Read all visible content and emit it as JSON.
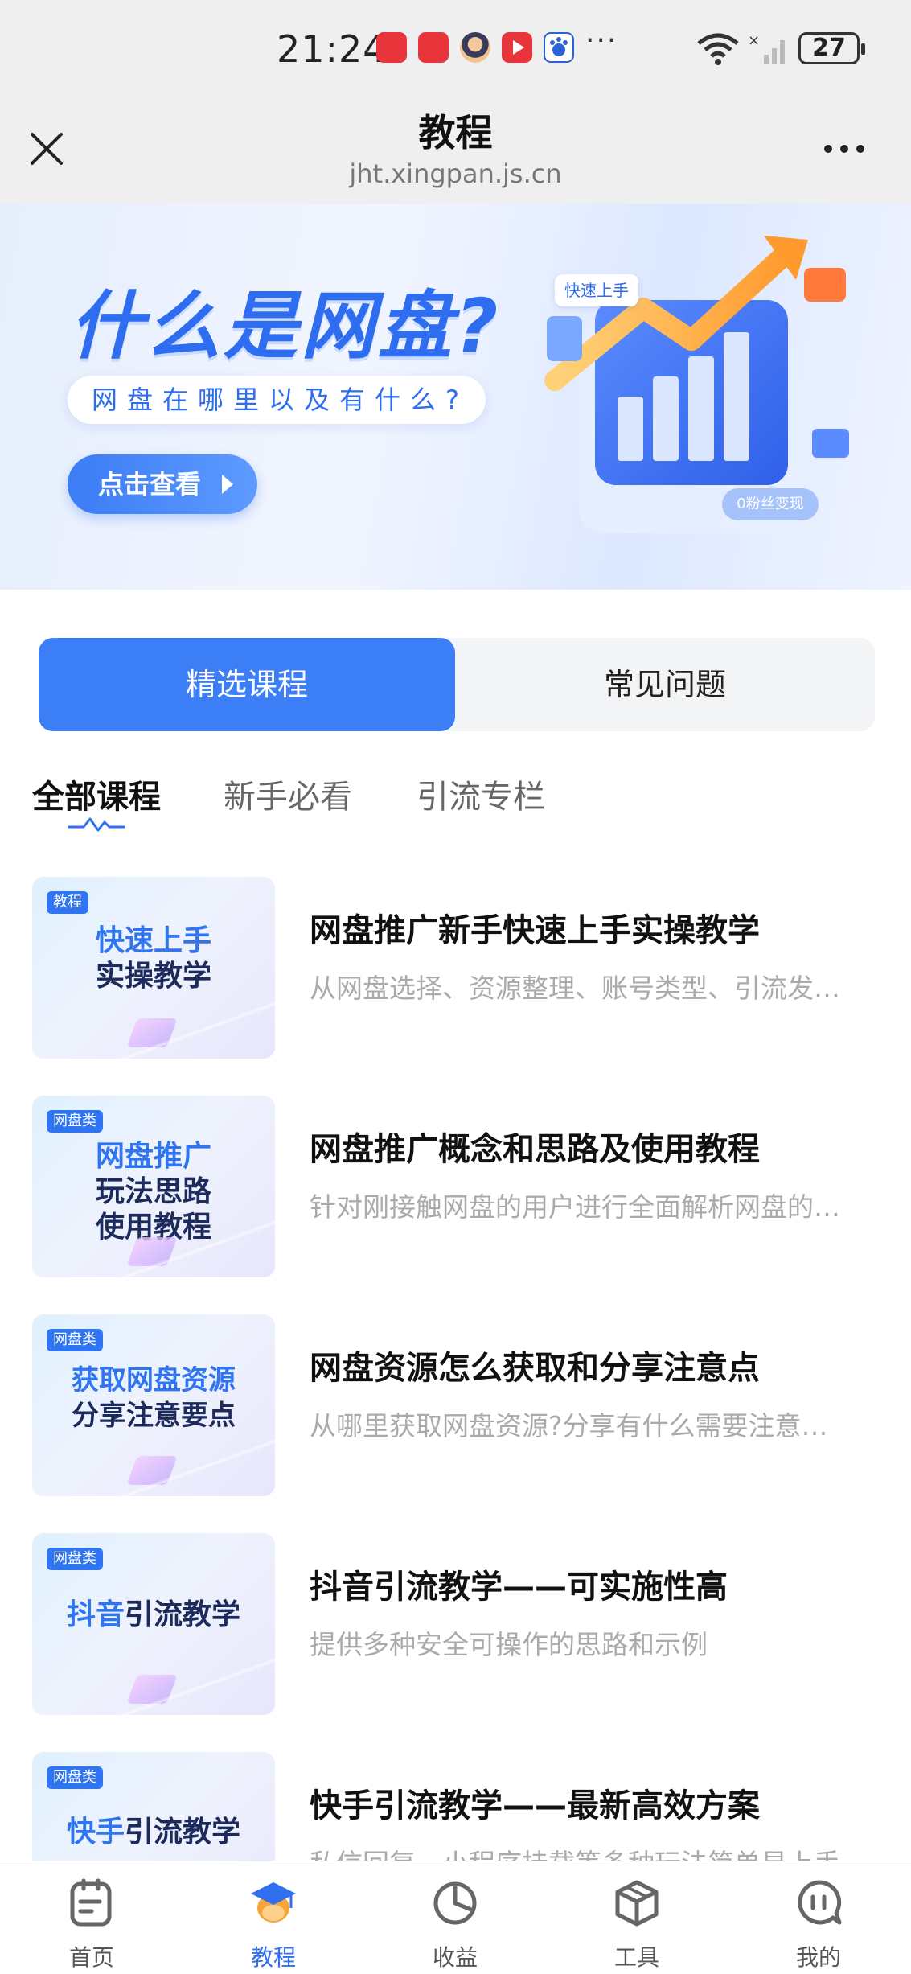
{
  "status_bar": {
    "time": "21:24",
    "battery": "27",
    "apps": [
      "huawei-store-icon",
      "huawei-store-icon",
      "avatar-app-icon",
      "video-app-icon",
      "baidu-app-icon"
    ],
    "more": "···"
  },
  "title_bar": {
    "title": "教程",
    "url": "jht.xingpan.js.cn"
  },
  "banner": {
    "title": "什么是网盘?",
    "subtitle": "网盘在哪里以及有什么?",
    "button": "点击查看",
    "tag_fast": "快速上手",
    "tag_fans": "0粉丝变现"
  },
  "segmented": {
    "active": "精选课程",
    "inactive": "常见问题"
  },
  "subtabs": [
    "全部课程",
    "新手必看",
    "引流专栏"
  ],
  "courses": [
    {
      "badge": "教程",
      "thumb_a": "快速上手",
      "thumb_b": "实操教学",
      "title": "网盘推广新手快速上手实操教学",
      "desc": "从网盘选择、资源整理、账号类型、引流发…"
    },
    {
      "badge": "网盘类",
      "thumb_a": "网盘推广",
      "thumb_b": "玩法思路",
      "thumb_c": "使用教程",
      "title": "网盘推广概念和思路及使用教程",
      "desc": "针对刚接触网盘的用户进行全面解析网盘的…"
    },
    {
      "badge": "网盘类",
      "thumb_a": "获取网盘资源",
      "thumb_b": "分享注意要点",
      "title": "网盘资源怎么获取和分享注意点",
      "desc": "从哪里获取网盘资源?分享有什么需要注意…"
    },
    {
      "badge": "网盘类",
      "thumb_hl": "抖音",
      "thumb_rest": "引流教学",
      "title": "抖音引流教学——可实施性高",
      "desc": "提供多种安全可操作的思路和示例"
    },
    {
      "badge": "网盘类",
      "thumb_hl": "快手",
      "thumb_rest": "引流教学",
      "title": "快手引流教学——最新高效方案",
      "desc": "私信回复、小程序挂载等多种玩法简单易上手"
    }
  ],
  "bottom_nav": [
    {
      "label": "首页",
      "icon": "document-icon"
    },
    {
      "label": "教程",
      "icon": "graduation-cap-icon"
    },
    {
      "label": "收益",
      "icon": "pie-chart-icon"
    },
    {
      "label": "工具",
      "icon": "box-icon"
    },
    {
      "label": "我的",
      "icon": "chat-icon"
    }
  ],
  "colors": {
    "accent": "#3b7ef6",
    "text": "#111111",
    "muted": "#aaaaaa"
  }
}
